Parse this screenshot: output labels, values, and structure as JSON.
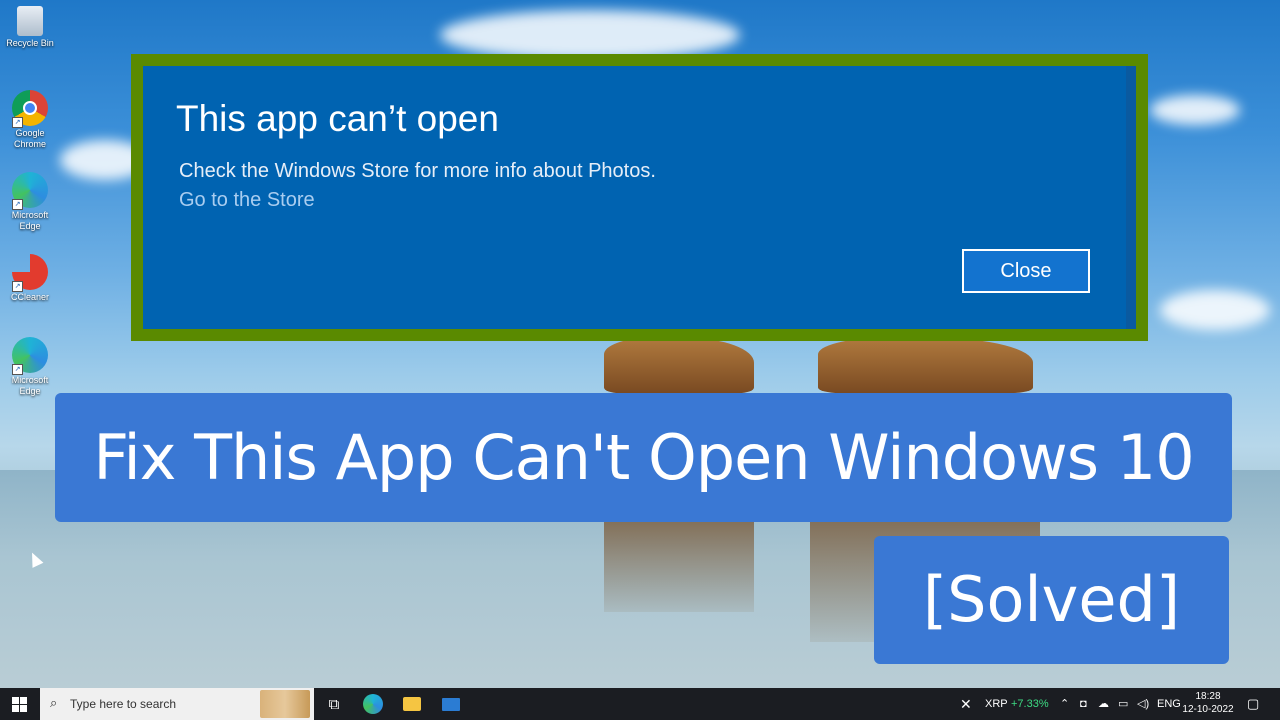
{
  "desktop": {
    "icons": [
      {
        "label": "Recycle Bin"
      },
      {
        "label": "Google Chrome"
      },
      {
        "label": "Microsoft Edge"
      },
      {
        "label": "CCleaner"
      },
      {
        "label": "Microsoft Edge"
      }
    ]
  },
  "dialog": {
    "title": "This app can’t open",
    "message": "Check the Windows Store for more info about Photos.",
    "link": "Go to the Store",
    "close_label": "Close"
  },
  "banner": {
    "main": "Fix This App Can't Open Windows 10",
    "sub": "[Solved]"
  },
  "taskbar": {
    "search_placeholder": "Type here to search",
    "ticker": "XRP",
    "ticker_change": "+7.33%",
    "language": "ENG",
    "time": "18:28",
    "date": "12-10-2022"
  },
  "colors": {
    "dialog_bg": "#0063b1",
    "dialog_border": "#5a8a00",
    "banner_bg": "#3a78d4",
    "ticker_up": "#3ddc84"
  },
  "icons": [
    "recycle-bin-icon",
    "chrome-icon",
    "edge-icon",
    "ccleaner-icon",
    "windows-start-icon",
    "search-icon",
    "task-view-icon",
    "file-explorer-icon",
    "mail-icon",
    "notification-icon"
  ]
}
